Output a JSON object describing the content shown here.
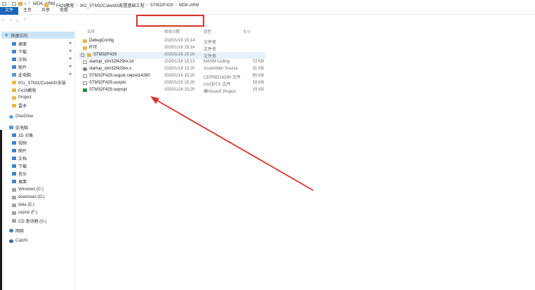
{
  "window": {
    "title": "MDK-ARM"
  },
  "ribbon": {
    "tabs": [
      "文件",
      "主页",
      "共享",
      "查看"
    ]
  },
  "address": {
    "segments": [
      "F429教程",
      "002_STM32CubeMX配置基础工程",
      "STM32F429",
      "MDK-ARM"
    ]
  },
  "columns": {
    "name": "名称",
    "date": "修改日期",
    "type": "类型",
    "size": "大小"
  },
  "sidebar": {
    "items": [
      {
        "label": "快速访问",
        "icon": "star-icon"
      },
      {
        "label": "桌面",
        "icon": "desktop-icon"
      },
      {
        "label": "下载",
        "icon": "download-icon"
      },
      {
        "label": "文档",
        "icon": "document-icon"
      },
      {
        "label": "图片",
        "icon": "picture-icon"
      },
      {
        "label": "此电脑",
        "icon": "pc-icon"
      },
      {
        "label": "001_STM32CubeMX安装",
        "icon": "folder-icon"
      },
      {
        "label": "F429教程",
        "icon": "folder-icon"
      },
      {
        "label": "Project",
        "icon": "folder-icon"
      },
      {
        "label": "雷矛",
        "icon": "folder-icon"
      },
      {
        "label": "OneDrive",
        "icon": "cloud-icon"
      },
      {
        "label": "此电脑",
        "icon": "pc-icon"
      },
      {
        "label": "3D 对象",
        "icon": "cube-icon"
      },
      {
        "label": "视频",
        "icon": "video-icon"
      },
      {
        "label": "图片",
        "icon": "picture-icon"
      },
      {
        "label": "文档",
        "icon": "document-icon"
      },
      {
        "label": "下载",
        "icon": "download-icon"
      },
      {
        "label": "音乐",
        "icon": "music-icon"
      },
      {
        "label": "桌面",
        "icon": "desktop-icon"
      },
      {
        "label": "Windows (C:)",
        "icon": "drive-icon"
      },
      {
        "label": "download (D:)",
        "icon": "drive-icon"
      },
      {
        "label": "data (E:)",
        "icon": "drive-icon"
      },
      {
        "label": "ceprei (F:)",
        "icon": "drive-icon"
      },
      {
        "label": "CD 驱动器 (G:)",
        "icon": "cd-drive-icon"
      },
      {
        "label": "网络",
        "icon": "network-icon"
      },
      {
        "label": "CatchI",
        "icon": "catch-icon"
      }
    ]
  },
  "files": [
    {
      "name": "DebugConfig",
      "date": "2020/1/16 15:14",
      "type": "文件夹",
      "size": "",
      "icon": "folder-icon"
    },
    {
      "name": "RTE",
      "date": "2020/1/16 15:14",
      "type": "文件夹",
      "size": "",
      "icon": "folder-icon"
    },
    {
      "name": "STM32F429",
      "date": "2020/1/16 15:20",
      "type": "文件夹",
      "size": "",
      "icon": "folder-icon"
    },
    {
      "name": "startup_stm32f429xx.lst",
      "date": "2020/1/16 15:13",
      "type": "MASM Listing",
      "size": "72 KB",
      "icon": "document-icon"
    },
    {
      "name": "startup_stm32f429xx.s",
      "date": "2020/1/16 15:20",
      "type": "Assembler Source",
      "size": "31 KB",
      "icon": "gear-icon"
    },
    {
      "name": "STM32F429.uvguix.ceprei14290",
      "date": "2020/1/16 15:20",
      "type": "CEPREI14290 文件",
      "size": "85 KB",
      "icon": "document-icon"
    },
    {
      "name": "STM32F429.uvoptx",
      "date": "2020/1/16 15:20",
      "type": "UVOPTX 文件",
      "size": "18 KB",
      "icon": "document-icon"
    },
    {
      "name": "STM32F429.uvprojx",
      "date": "2020/1/16 15:20",
      "type": "礦Vision5 Project",
      "size": "19 KB",
      "icon": "keil-project-icon"
    }
  ],
  "colors": {
    "highlight_box": "#d9342b",
    "arrow": "#d9342b",
    "file_tab": "#1a65b8"
  }
}
